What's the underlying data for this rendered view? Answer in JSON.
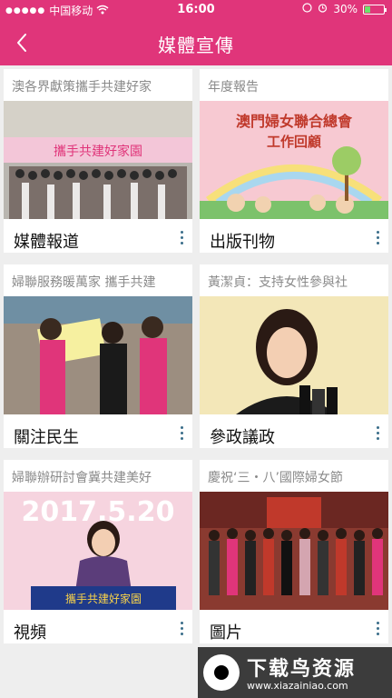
{
  "status_bar": {
    "carrier": "中国移动",
    "time": "16:00",
    "battery": "30%"
  },
  "nav": {
    "title": "媒體宣傳"
  },
  "cards": [
    {
      "caption": "澳各界獻策攜手共建好家",
      "label": "媒體報道"
    },
    {
      "caption": "年度報告",
      "label": "出版刊物"
    },
    {
      "caption": "婦聯服務暖萬家 攜手共建",
      "label": "關注民生"
    },
    {
      "caption": "黃潔貞：支持女性參與社",
      "label": "參政議政"
    },
    {
      "caption": "婦聯辦研討會冀共建美好",
      "label": "視頻"
    },
    {
      "caption": "慶祝‘三・八’國際婦女節",
      "label": "圖片"
    }
  ],
  "thumbs": {
    "report_line1": "澳門婦女聯合總會",
    "report_line2": "工作回顧",
    "video_date": "2017.5.20",
    "banner_1": "攜手共建好家園",
    "banner_5": "攜手共建好家園"
  },
  "watermark": {
    "title": "下载鸟资源",
    "url": "www.xiazainiao.com"
  }
}
